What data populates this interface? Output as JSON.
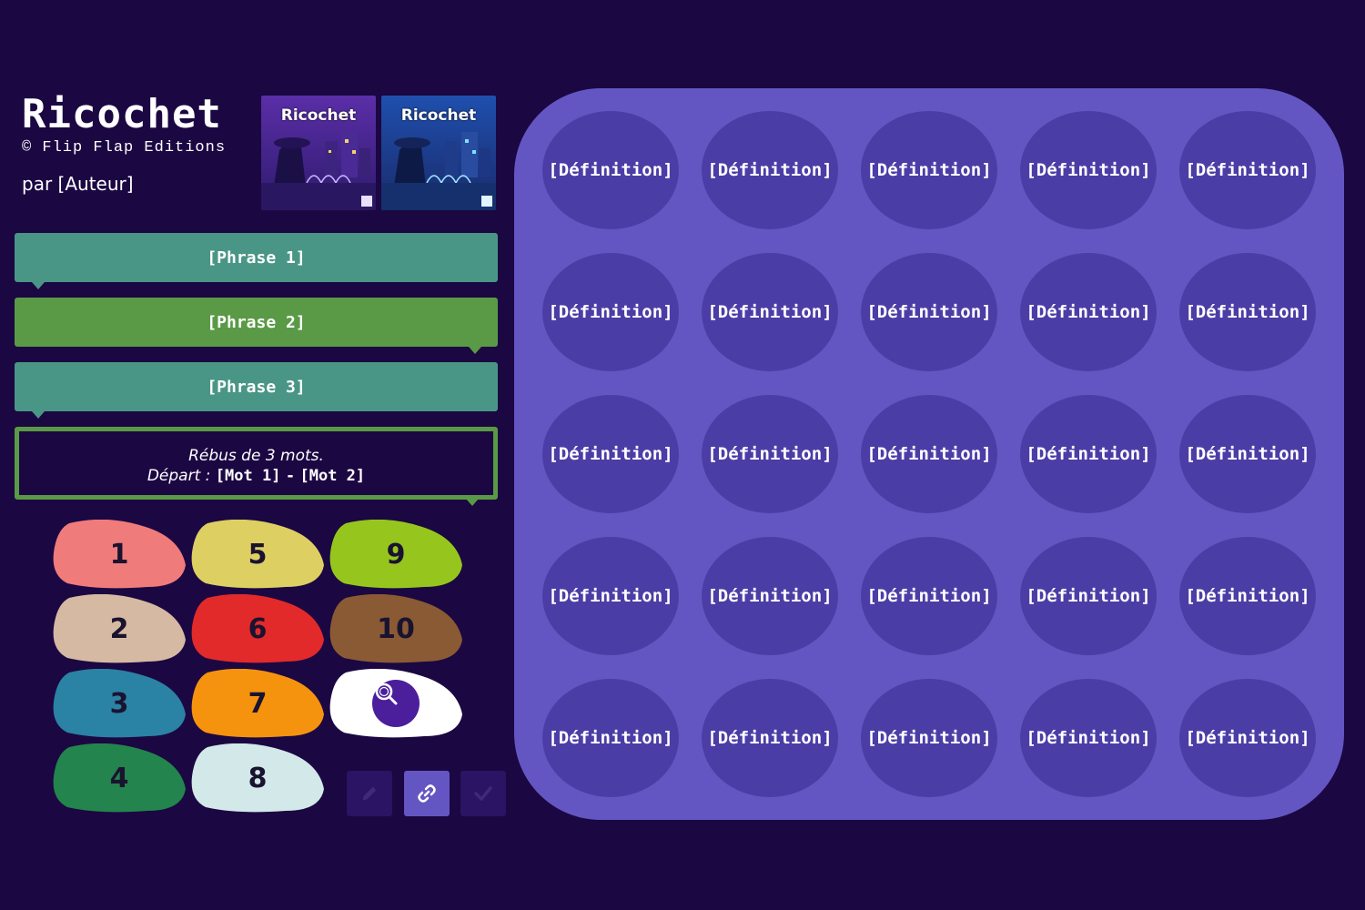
{
  "header": {
    "title": "Ricochet",
    "copyright": "© Flip Flap Editions",
    "author": "par [Auteur]",
    "covers": [
      {
        "title": "Ricochet"
      },
      {
        "title": "Ricochet"
      }
    ]
  },
  "phrases": [
    "[Phrase 1]",
    "[Phrase 2]",
    "[Phrase 3]"
  ],
  "rebus": {
    "line1": "Rébus de 3 mots.",
    "depart_label": "Départ :",
    "mot1": "[Mot 1]",
    "separator": "-",
    "mot2": "[Mot 2]"
  },
  "palette": [
    {
      "label": "1",
      "color": "#f07b7b"
    },
    {
      "label": "2",
      "color": "#d5b9a2"
    },
    {
      "label": "3",
      "color": "#2a82a4"
    },
    {
      "label": "4",
      "color": "#23844d"
    },
    {
      "label": "5",
      "color": "#ddcf62"
    },
    {
      "label": "6",
      "color": "#e22a2a"
    },
    {
      "label": "7",
      "color": "#f5930f"
    },
    {
      "label": "8",
      "color": "#d3e8e9"
    },
    {
      "label": "9",
      "color": "#96c61d"
    },
    {
      "label": "10",
      "color": "#8a5a34"
    },
    {
      "label": "",
      "color": "#ffffff",
      "icon": "magnifier-icon"
    }
  ],
  "tools": {
    "edit": "pencil-icon",
    "link": "link-icon",
    "check": "check-icon"
  },
  "grid": {
    "rows": 5,
    "cols": 5,
    "cell_label": "[Définition]"
  }
}
